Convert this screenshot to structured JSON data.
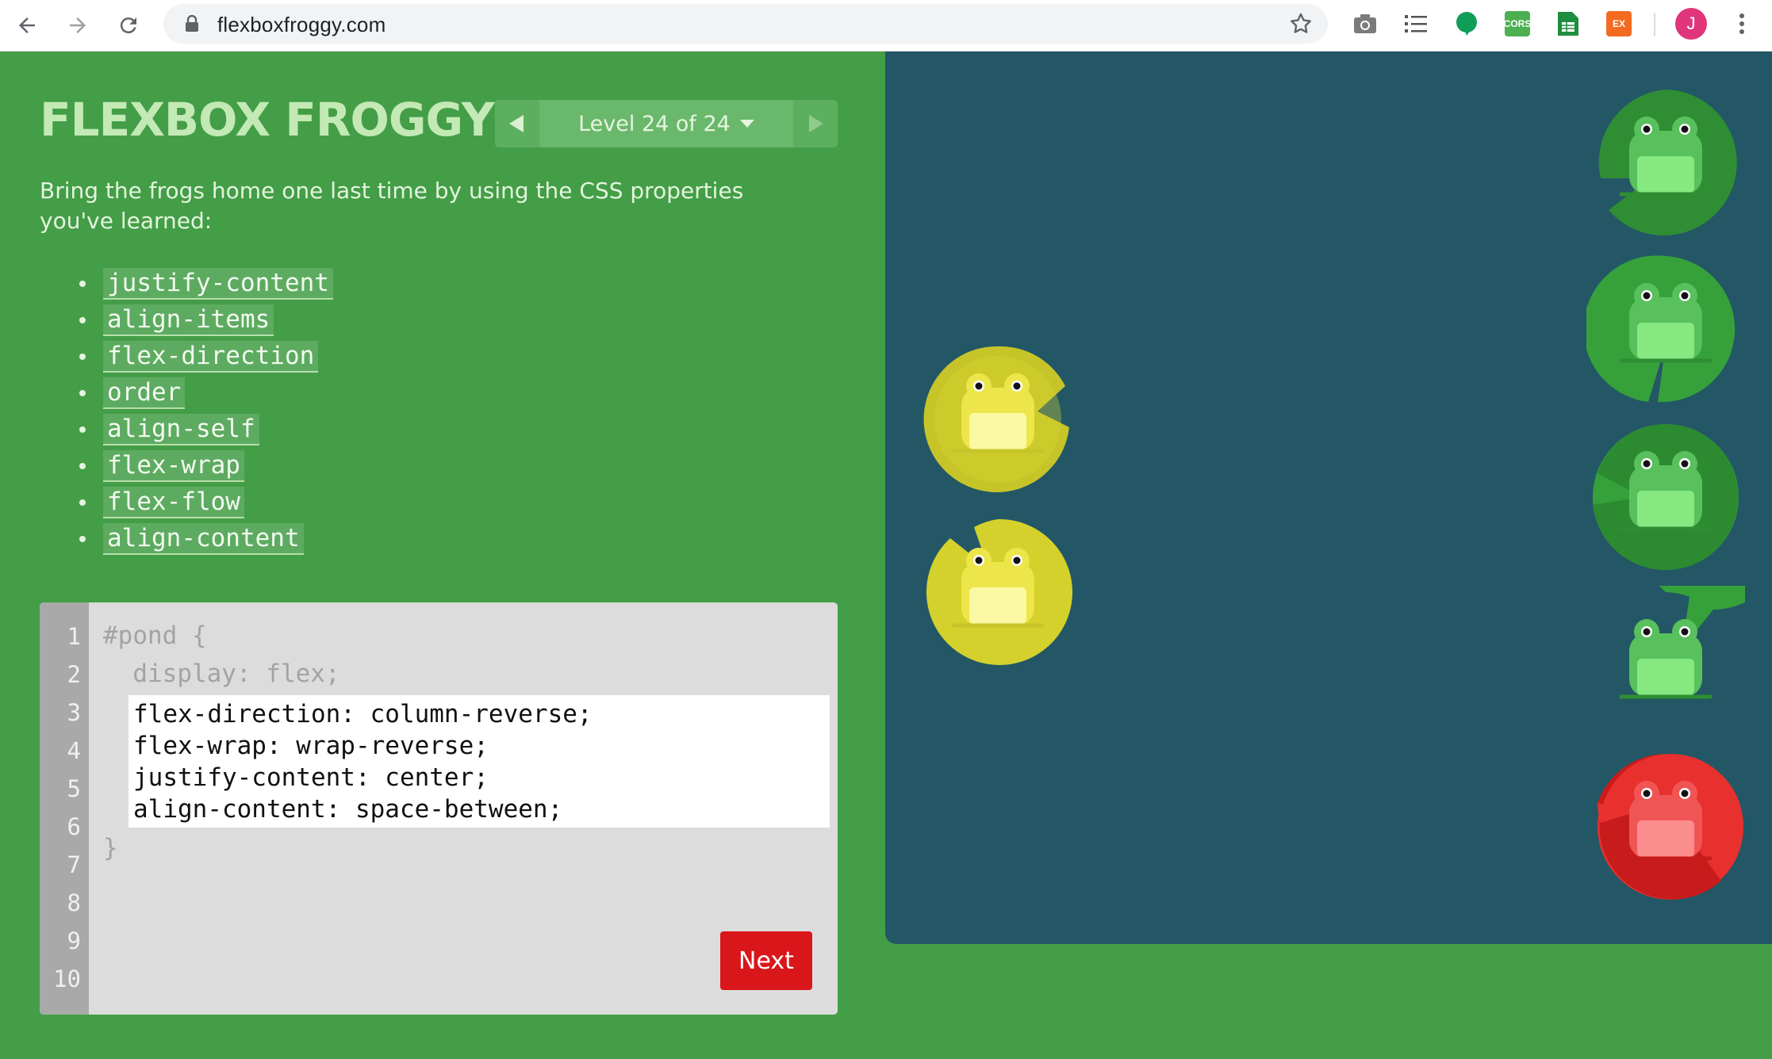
{
  "browser": {
    "url": "flexboxfroggy.com",
    "avatar_letter": "J",
    "extensions": [
      {
        "name": "camera-icon"
      },
      {
        "name": "list-icon"
      },
      {
        "name": "chat-bubble-icon",
        "color": "#0f9d58"
      },
      {
        "name": "cors-extension",
        "label": "CORS",
        "color": "#4caf50"
      },
      {
        "name": "sheet-extension",
        "color": "#1e8e3e"
      },
      {
        "name": "ex-extension",
        "label": "EX",
        "color": "#f26b21"
      }
    ]
  },
  "header": {
    "logo": "FLEXBOX FROGGY",
    "level_label": "Level 24 of 24"
  },
  "instructions": "Bring the frogs home one last time by using the CSS properties you've learned:",
  "properties": [
    "justify-content",
    "align-items",
    "flex-direction",
    "order",
    "align-self",
    "flex-wrap",
    "flex-flow",
    "align-content"
  ],
  "editor": {
    "line_numbers": [
      "1",
      "2",
      "3",
      "4",
      "5",
      "6",
      "7",
      "8",
      "9",
      "10"
    ],
    "before": [
      "#pond {",
      "  display: flex;"
    ],
    "input_lines": [
      "flex-direction: column-reverse;",
      "flex-wrap: wrap-reverse;",
      "justify-content: center;",
      "align-content: space-between;"
    ],
    "after": [
      "}"
    ],
    "next_label": "Next"
  },
  "colors": {
    "background": "#439e47",
    "pond": "#235766",
    "green_pad": "#3c9a3c",
    "yellow_pad": "#c7c42a",
    "red_pad": "#d21d1d",
    "next_button": "#d9161a"
  },
  "pond": {
    "frogs": [
      {
        "color": "yellow"
      },
      {
        "color": "yellow"
      },
      {
        "color": "green"
      },
      {
        "color": "green"
      },
      {
        "color": "green"
      },
      {
        "color": "green"
      },
      {
        "color": "red"
      }
    ]
  }
}
